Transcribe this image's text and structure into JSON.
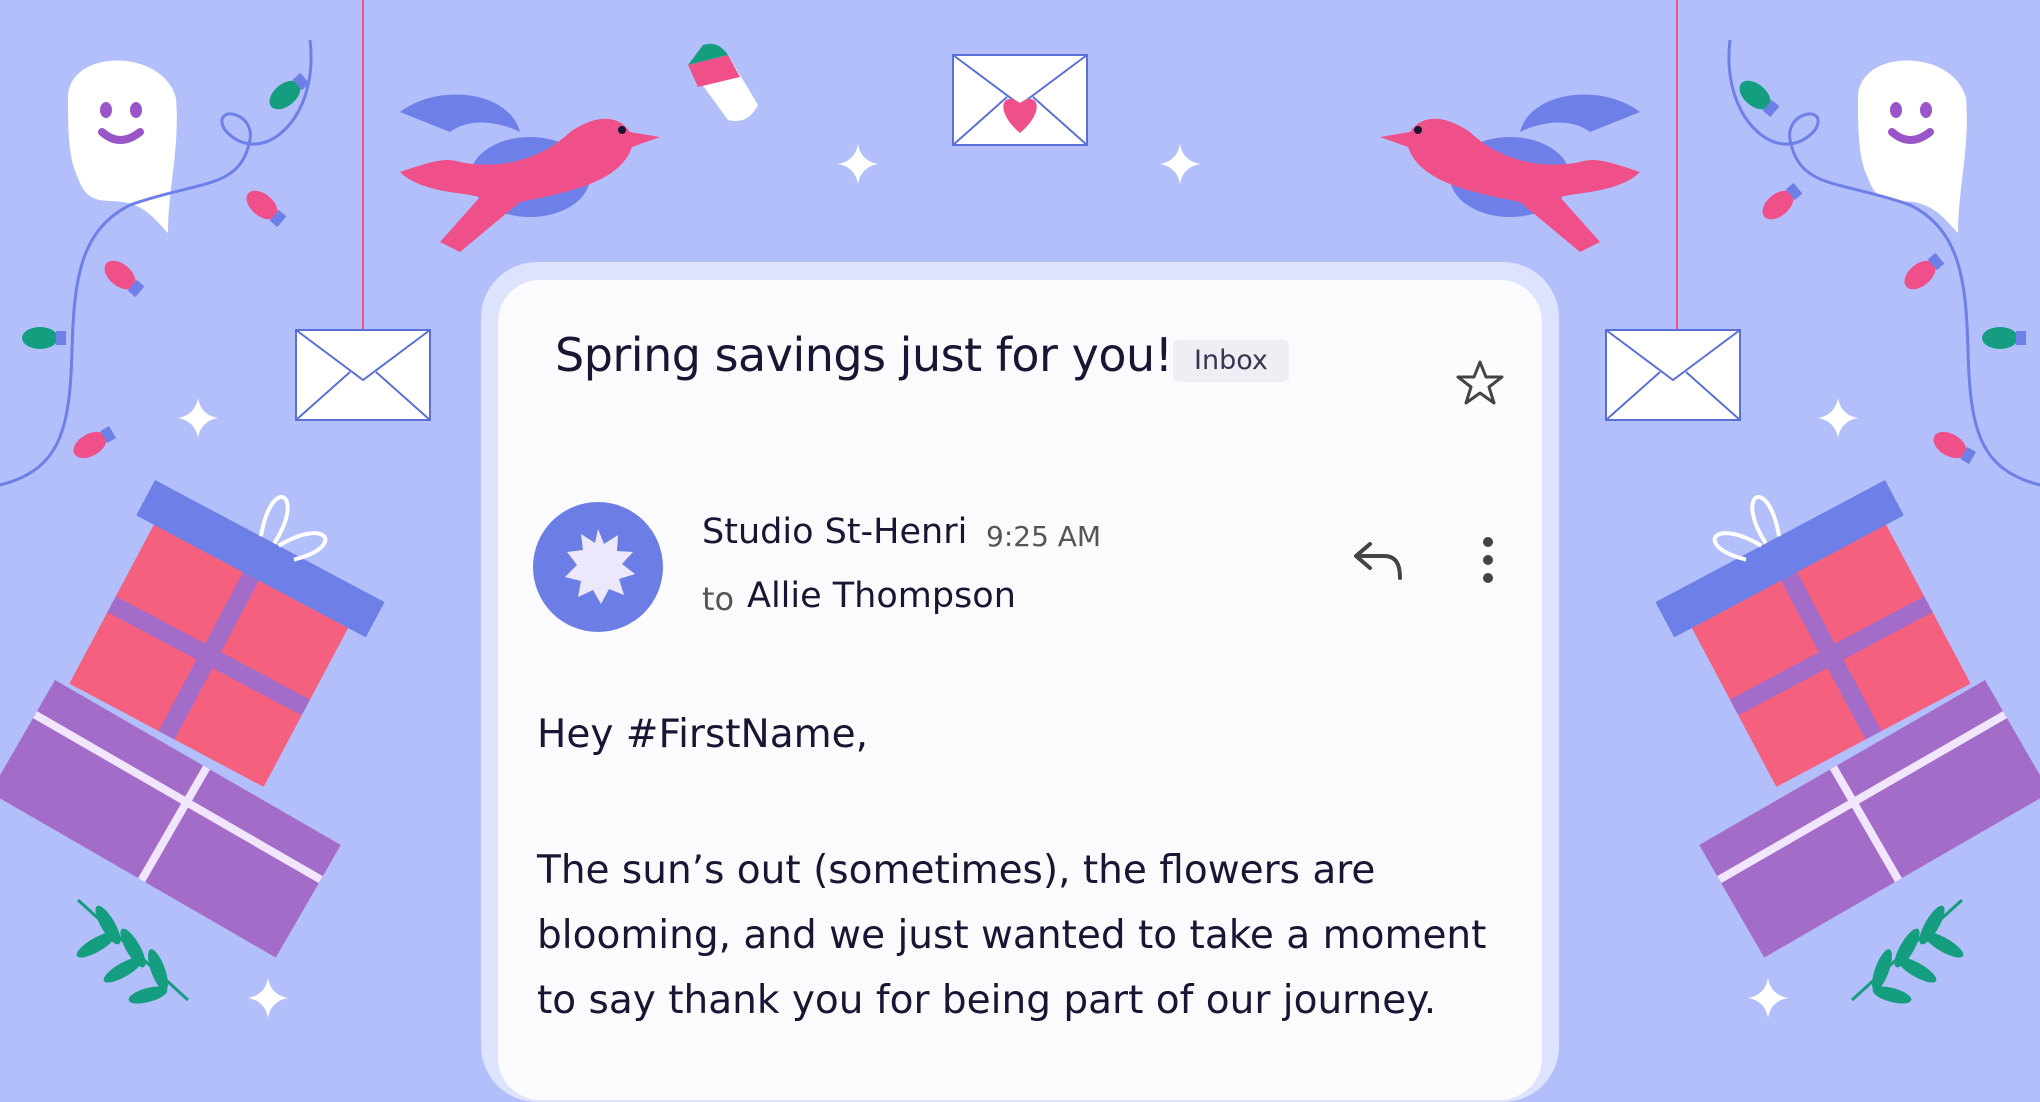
{
  "email": {
    "subject": "Spring savings just for you!",
    "label_badge": "Inbox",
    "sender_name": "Studio St-Henri",
    "time": "9:25 AM",
    "to_label": "to",
    "recipient": "Allie Thompson",
    "greeting": "Hey #FirstName,",
    "body": "The sun’s out (sometimes), the flowers are blooming, and we just wanted to take a moment to say thank you for being part of our journey."
  },
  "icons": {
    "star": "star-outline-icon",
    "reply": "reply-arrow-icon",
    "more": "vertical-dots-icon",
    "avatar": "sunburst-logo"
  },
  "colors": {
    "background": "#b3bffa",
    "card": "#fbfbfe",
    "card_border": "#dde2fd",
    "avatar_bg": "#6c7ee6",
    "avatar_badge": "#ede7fb",
    "gift_red": "#f6607f",
    "gift_purple": "#a36cc9",
    "ribbon_blue": "#6e80e8",
    "leaf_green": "#149e7f",
    "bird_pink": "#f0508a",
    "bird_blue": "#6e80e8"
  }
}
